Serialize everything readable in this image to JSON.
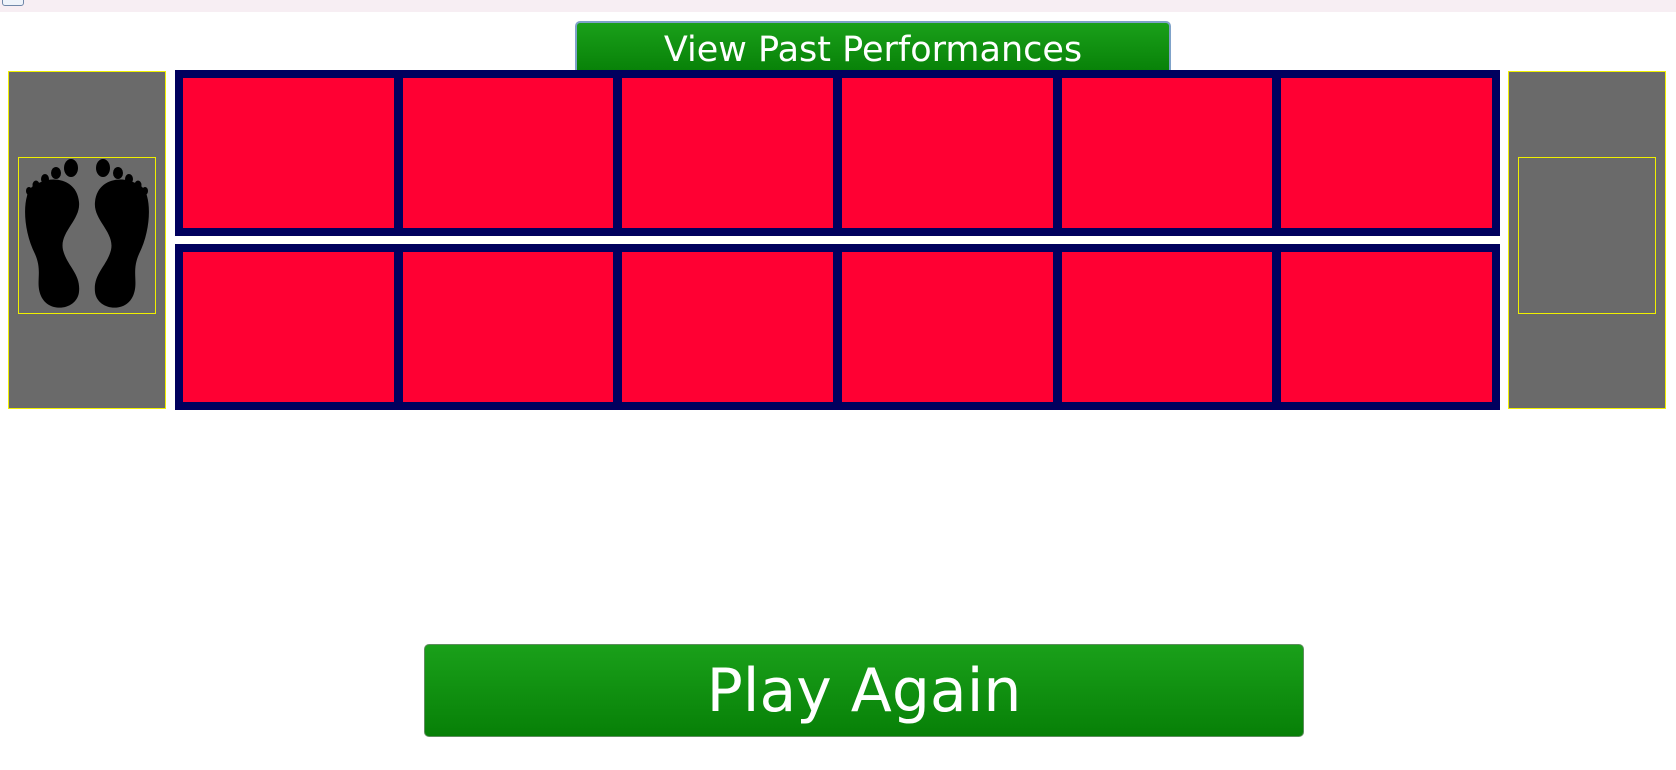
{
  "buttons": {
    "view_past_performances": "View Past Performances",
    "play_again": "Play Again"
  },
  "left_panel": {
    "icon": "footprints-icon"
  },
  "right_panel": {
    "icon": null
  },
  "grid": {
    "rows": 2,
    "columns": 6,
    "tile_color": "#ff0033",
    "frame_color": "#00005e"
  },
  "colors": {
    "button_green": "#0b8f0b",
    "panel_gray": "#6a6a6a",
    "panel_border": "#f0f000"
  }
}
